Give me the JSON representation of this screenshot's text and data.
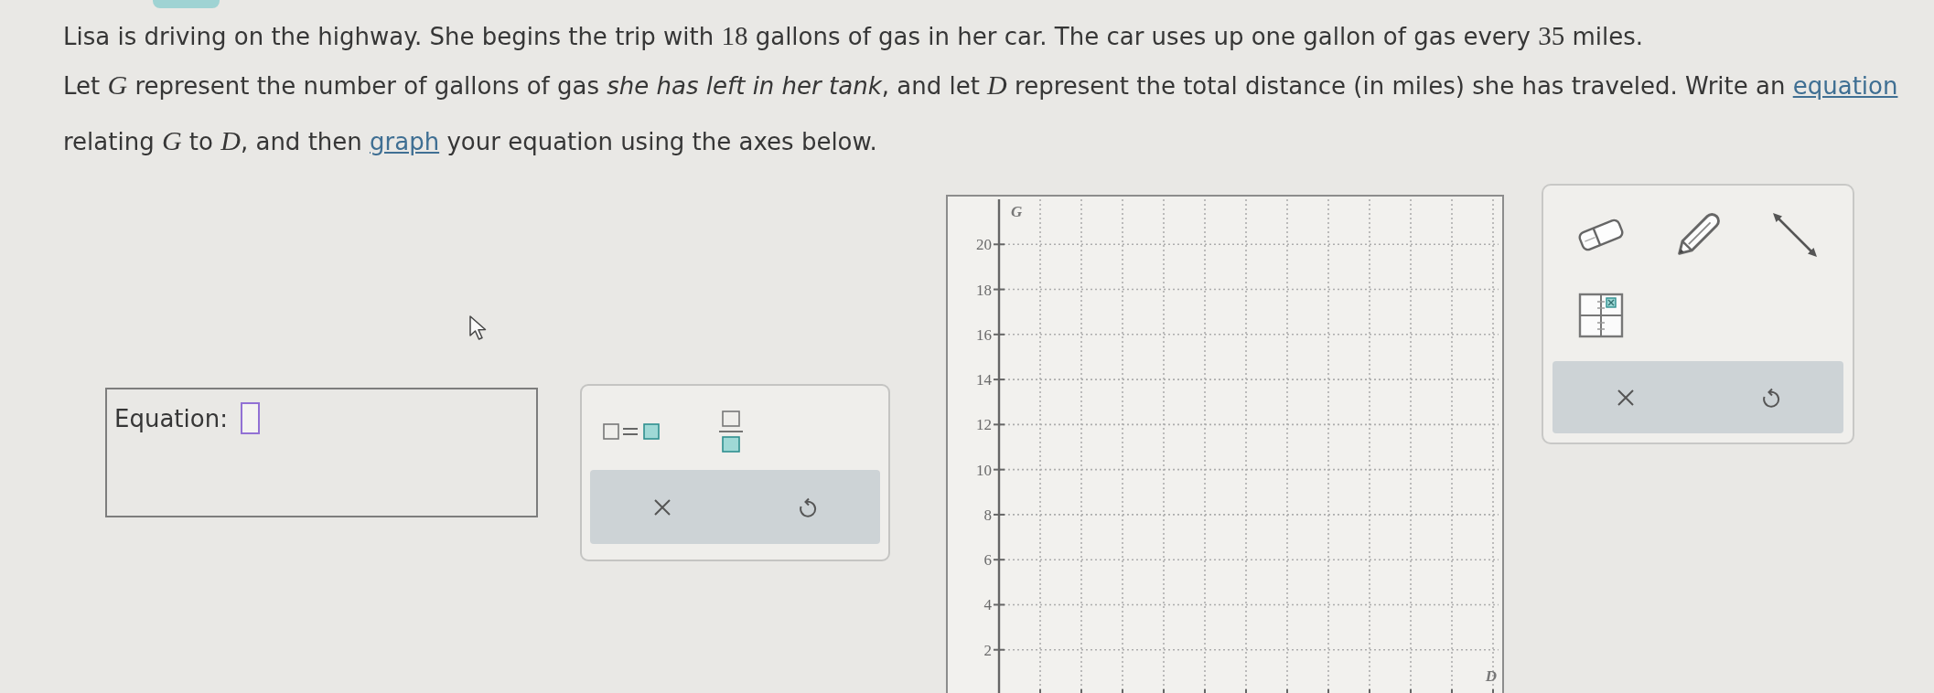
{
  "problem": {
    "segments": [
      {
        "kind": "text",
        "text": "Lisa is driving on the highway. She begins the trip with "
      },
      {
        "kind": "num",
        "text": "18"
      },
      {
        "kind": "text",
        "text": " gallons of gas in her car. The car uses up one gallon of gas every "
      },
      {
        "kind": "num",
        "text": "35"
      },
      {
        "kind": "text",
        "text": " miles."
      }
    ]
  },
  "question": {
    "lines": [
      [
        {
          "kind": "text",
          "text": "Let "
        },
        {
          "kind": "var",
          "text": "G"
        },
        {
          "kind": "text",
          "text": " represent the number of gallons of gas "
        },
        {
          "kind": "emph",
          "text": "she has left in her tank"
        },
        {
          "kind": "text",
          "text": ", and let "
        },
        {
          "kind": "var",
          "text": "D"
        },
        {
          "kind": "text",
          "text": " represent the total distance (in miles) she has traveled. Write an "
        },
        {
          "kind": "link",
          "text": "equation"
        }
      ],
      [
        {
          "kind": "text",
          "text": "relating "
        },
        {
          "kind": "var",
          "text": "G"
        },
        {
          "kind": "text",
          "text": " to "
        },
        {
          "kind": "var",
          "text": "D"
        },
        {
          "kind": "text",
          "text": ", and then "
        },
        {
          "kind": "link",
          "text": "graph"
        },
        {
          "kind": "text",
          "text": " your equation using the axes below."
        }
      ]
    ]
  },
  "equation": {
    "label": "Equation:"
  },
  "keypad": {
    "templates": [
      {
        "kind": "equals"
      },
      {
        "kind": "fraction"
      }
    ],
    "actions": [
      {
        "kind": "clear"
      },
      {
        "kind": "undo"
      }
    ]
  },
  "graph": {
    "chart_data": {
      "type": "line",
      "xlabel": "D",
      "ylabel": "G",
      "categories": [
        null,
        null,
        null,
        null,
        null,
        null,
        null,
        null,
        null,
        null,
        null,
        null
      ],
      "ylim": [
        0,
        22
      ],
      "yticks": [
        2,
        4,
        6,
        8,
        10,
        12,
        14,
        16,
        18,
        20
      ],
      "grid": true
    }
  },
  "graph_tools": {
    "tools": [
      {
        "kind": "eraser"
      },
      {
        "kind": "pencil"
      },
      {
        "kind": "line"
      },
      {
        "kind": "point_grid"
      }
    ],
    "actions": [
      {
        "kind": "clear"
      },
      {
        "kind": "undo"
      }
    ]
  }
}
